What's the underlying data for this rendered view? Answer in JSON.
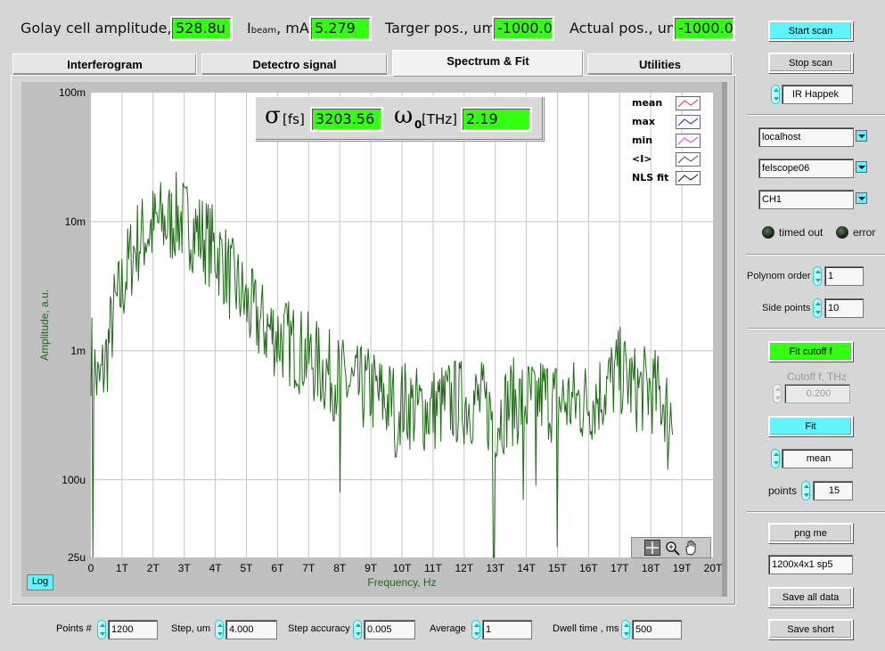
{
  "header": {
    "golay_label": "Golay cell amplitude, V",
    "golay_value": "528.8u",
    "ibeam_label_main": "I",
    "ibeam_label_sub": "beam",
    "ibeam_label_unit": ", mA",
    "ibeam_value": "5.279",
    "target_label": "Targer pos., um",
    "target_value": "-1000.0",
    "actual_label": "Actual pos., um",
    "actual_value": "-1000.0"
  },
  "tabs": [
    {
      "label": "Interferogram",
      "active": false
    },
    {
      "label": "Detectro signal",
      "active": false
    },
    {
      "label": "Spectrum & Fit",
      "active": true
    },
    {
      "label": "Utilities",
      "active": false
    }
  ],
  "fitbox": {
    "sigma_symbol": "σ",
    "sigma_unit": "[fs]",
    "sigma_value": "3203.56",
    "omega_symbol": "ω",
    "omega_sub": "0",
    "omega_unit": "[THz]",
    "omega_value": "2.19"
  },
  "legend": [
    {
      "label": "mean",
      "color": "#e0302c"
    },
    {
      "label": "max",
      "color": "#1a1acc"
    },
    {
      "label": "min",
      "color": "#d43ad4"
    },
    {
      "label": "<I>",
      "color": "#1f6a16"
    },
    {
      "label": "NLS fit",
      "color": "#111111"
    }
  ],
  "plot": {
    "log_button": "Log",
    "ylabel": "Amplitude, a.u.",
    "xlabel": "Frequency, Hz",
    "ytick_labels": [
      "100m",
      "10m",
      "1m",
      "100u",
      "25u"
    ],
    "xtick_labels": [
      "0",
      "1T",
      "2T",
      "3T",
      "4T",
      "5T",
      "6T",
      "7T",
      "8T",
      "9T",
      "10T",
      "11T",
      "12T",
      "13T",
      "14T",
      "15T",
      "16T",
      "17T",
      "18T",
      "19T",
      "20T"
    ]
  },
  "chart_data": {
    "type": "line",
    "xlabel": "Frequency, Hz",
    "ylabel": "Amplitude, a.u.",
    "xlim": [
      0,
      20000000000000
    ],
    "ylim": [
      2.5e-05,
      0.1
    ],
    "y_scale": "log",
    "grid": true,
    "legend_placement": "top-right",
    "series": [
      {
        "name": "<I>",
        "color": "#1f6a16",
        "x_thz": [
          0,
          0.25,
          0.5,
          0.75,
          1.0,
          1.25,
          1.5,
          1.75,
          2.0,
          2.25,
          2.5,
          2.75,
          3.0,
          3.25,
          3.5,
          3.75,
          4.0,
          4.25,
          4.5,
          4.75,
          5.0,
          5.5,
          6.0,
          6.5,
          7.0,
          7.5,
          8.0,
          8.5,
          9.0,
          9.5,
          10.0,
          10.5,
          11.0,
          11.5,
          12.0,
          12.5,
          13.0,
          13.5,
          14.0,
          14.5,
          15.0,
          15.5,
          16.0,
          16.5,
          17.0,
          17.5,
          18.0,
          18.5,
          18.7
        ],
        "y": [
          0.001,
          0.0005,
          0.0009,
          0.002,
          0.003,
          0.005,
          0.007,
          0.008,
          0.009,
          0.01,
          0.0095,
          0.011,
          0.01,
          0.009,
          0.008,
          0.007,
          0.006,
          0.005,
          0.0035,
          0.003,
          0.0022,
          0.0016,
          0.0013,
          0.0011,
          0.0009,
          0.0007,
          0.0006,
          0.0005,
          0.0005,
          0.0004,
          0.0004,
          0.00035,
          0.00035,
          0.0004,
          0.0004,
          0.0004,
          0.0003,
          0.0004,
          0.0004,
          0.00045,
          0.0004,
          0.0004,
          0.0004,
          0.0005,
          0.0007,
          0.0005,
          0.0005,
          0.0004,
          0.0003
        ]
      }
    ]
  },
  "zoom_tools": [
    "cursor-tool-icon",
    "zoom-tool-icon",
    "pan-tool-icon"
  ],
  "right": {
    "start_scan": "Start scan",
    "stop_scan": "Stop scan",
    "source_select": "IR Happek",
    "host": "localhost",
    "scope": "felscope06",
    "channel": "CH1",
    "timed_out": "timed out",
    "error": "error",
    "polynom_label": "Polynom order",
    "polynom_value": "1",
    "side_label": "Side points",
    "side_value": "10",
    "fit_cutoff": "Fit cutoff f",
    "cutoff_label": "Cutoff f, THz",
    "cutoff_value": "0.200",
    "fit": "Fit",
    "mean_select": "mean",
    "points_label": "points",
    "points_value": "15",
    "png_me": "png me",
    "filename": "1200x4x1 sp5",
    "save_all": "Save all data",
    "save_short": "Save short"
  },
  "bottom": {
    "points_label": "Points #",
    "points_value": "1200",
    "step_label": "Step, um",
    "step_value": "4.000",
    "accuracy_label": "Step accuracy",
    "accuracy_value": "0.005",
    "average_label": "Average",
    "average_value": "1",
    "dwell_label": "Dwell time , ms",
    "dwell_value": "500"
  }
}
